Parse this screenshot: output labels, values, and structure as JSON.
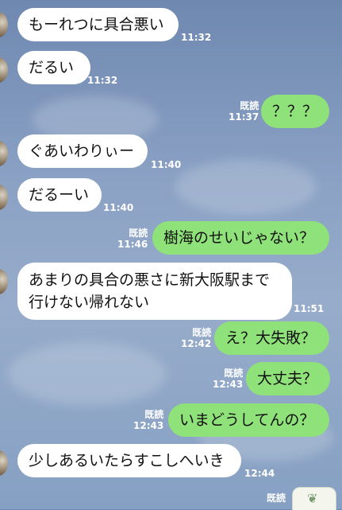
{
  "chat": {
    "messages": [
      {
        "dir": "in",
        "text": "もーれつに具合悪い",
        "time": "11:32"
      },
      {
        "dir": "in",
        "text": "だるい",
        "time": "11:32"
      },
      {
        "dir": "out",
        "text": "？？？",
        "time": "11:37",
        "read": "既読"
      },
      {
        "dir": "in",
        "text": "ぐあいわりぃー",
        "time": "11:40"
      },
      {
        "dir": "in",
        "text": "だるーい",
        "time": "11:40"
      },
      {
        "dir": "out",
        "text": "樹海のせいじゃない？",
        "time": "11:46",
        "read": "既読"
      },
      {
        "dir": "in",
        "text": "あまりの具合の悪さに新大阪駅まで行けない帰れない",
        "time": "11:51"
      },
      {
        "dir": "out",
        "text": "え？大失敗？",
        "time": "12:42",
        "read": "既読"
      },
      {
        "dir": "out",
        "text": "大丈夫？",
        "time": "12:43",
        "read": "既読"
      },
      {
        "dir": "out",
        "text": "いまどうしてんの？",
        "time": "12:43",
        "read": "既読"
      },
      {
        "dir": "in",
        "text": "少しあるいたらすこしへいき",
        "time": "12:44"
      },
      {
        "dir": "out",
        "text": "",
        "time": "",
        "read": "既読"
      }
    ]
  }
}
